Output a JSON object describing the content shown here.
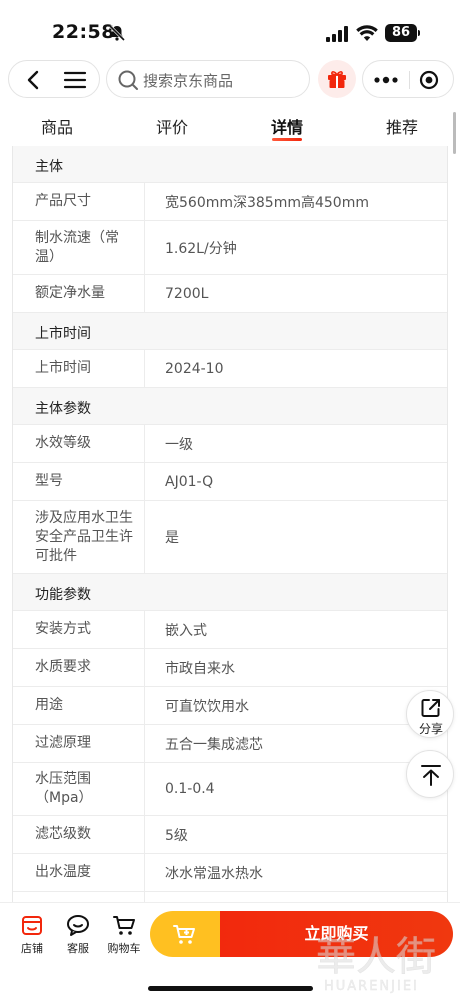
{
  "status_bar": {
    "time": "22:58",
    "battery": "86"
  },
  "search": {
    "placeholder": "搜索京东商品"
  },
  "tabs": [
    {
      "label": "商品",
      "active": false
    },
    {
      "label": "评价",
      "active": false
    },
    {
      "label": "详情",
      "active": true
    },
    {
      "label": "推荐",
      "active": false
    }
  ],
  "specs": [
    {
      "type": "section",
      "title": "主体"
    },
    {
      "type": "row",
      "name": "产品尺寸",
      "value": "宽560mm深385mm高450mm"
    },
    {
      "type": "row",
      "name": "制水流速（常温）",
      "value": "1.62L/分钟"
    },
    {
      "type": "row",
      "name": "额定净水量",
      "value": "7200L"
    },
    {
      "type": "section",
      "title": "上市时间"
    },
    {
      "type": "row",
      "name": "上市时间",
      "value": "2024-10"
    },
    {
      "type": "section",
      "title": "主体参数"
    },
    {
      "type": "row",
      "name": "水效等级",
      "value": "一级"
    },
    {
      "type": "row",
      "name": "型号",
      "value": "AJ01-Q"
    },
    {
      "type": "row",
      "name": "涉及应用水卫生安全产品卫生许可批件",
      "value": "是"
    },
    {
      "type": "section",
      "title": "功能参数"
    },
    {
      "type": "row",
      "name": "安装方式",
      "value": "嵌入式"
    },
    {
      "type": "row",
      "name": "水质要求",
      "value": "市政自来水"
    },
    {
      "type": "row",
      "name": "用途",
      "value": "可直饮饮用水"
    },
    {
      "type": "row",
      "name": "过滤原理",
      "value": "五合一集成滤芯"
    },
    {
      "type": "row",
      "name": "水压范围（Mpa）",
      "value": "0.1-0.4"
    },
    {
      "type": "row",
      "name": "滤芯级数",
      "value": "5级"
    },
    {
      "type": "row",
      "name": "出水温度",
      "value": "冰水常温水热水"
    }
  ],
  "floating": {
    "share_label": "分享"
  },
  "bottom_bar": {
    "store_label": "店铺",
    "service_label": "客服",
    "cart_label": "购物车",
    "buy_label": "立即购买"
  },
  "watermark": {
    "text_cn": "華人街",
    "text_en": "HUARENJIEI"
  },
  "colors": {
    "accent": "#f2270c",
    "cart_yellow": "#ffc021",
    "section_bg": "#f7f7f7"
  }
}
